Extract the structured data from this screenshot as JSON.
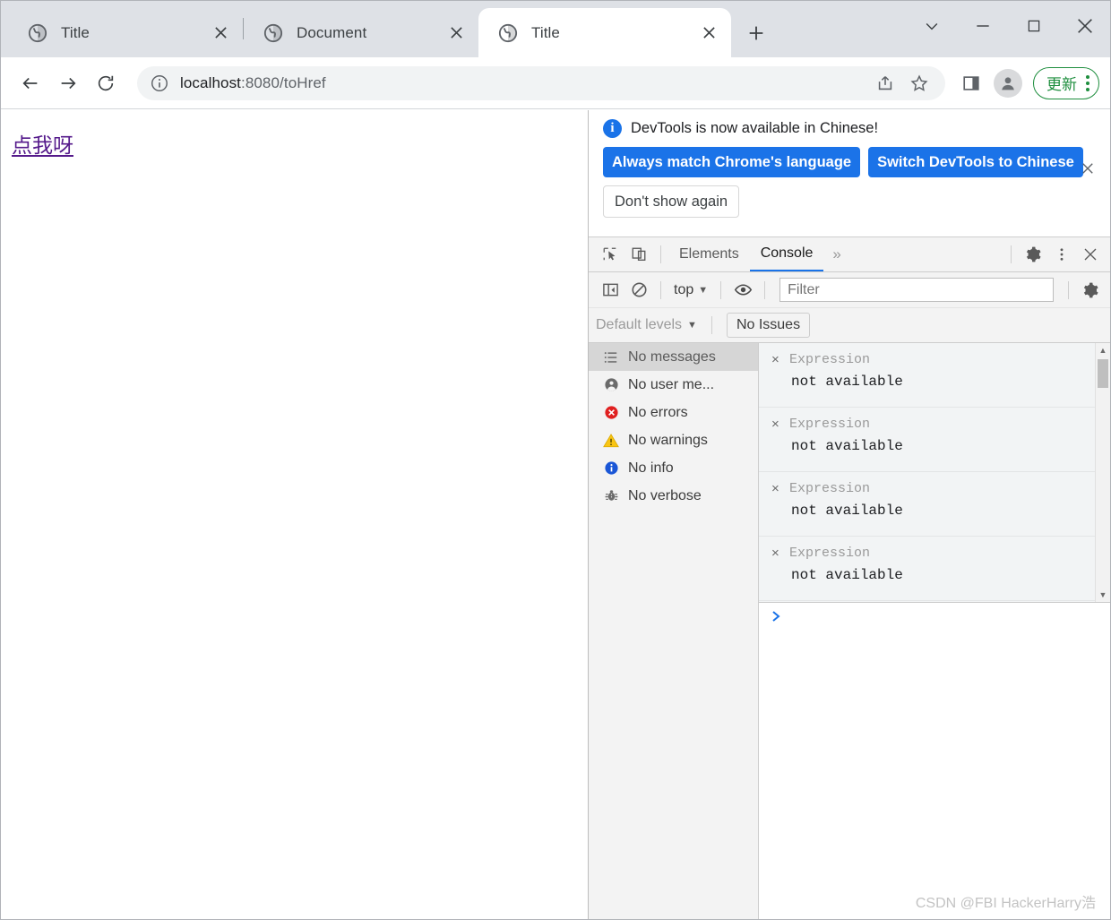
{
  "browser": {
    "tabs": [
      {
        "title": "Title",
        "active": false,
        "favicon": "globe-icon"
      },
      {
        "title": "Document",
        "active": false,
        "favicon": "globe-icon"
      },
      {
        "title": "Title",
        "active": true,
        "favicon": "globe-icon"
      }
    ],
    "new_tab_label": "+",
    "window_controls": {
      "tab_search": "chevron-down-icon",
      "minimize": "minimize-icon",
      "maximize": "maximize-icon",
      "close": "close-icon"
    },
    "toolbar": {
      "back": "back-arrow-icon",
      "forward": "forward-arrow-icon",
      "reload": "reload-icon",
      "site_info": "info-circle-icon",
      "url_host": "localhost",
      "url_rest": ":8080/toHref",
      "share": "share-icon",
      "bookmark": "star-icon",
      "side_panel": "side-panel-icon",
      "profile": "profile-avatar-icon",
      "update_label": "更新",
      "menu": "kebab-menu-icon"
    }
  },
  "page": {
    "link_text": "点我呀"
  },
  "devtools": {
    "infobar": {
      "message": "DevTools is now available in Chinese!",
      "primary_buttons": [
        "Always match Chrome's language",
        "Switch DevTools to Chinese"
      ],
      "secondary_button": "Don't show again",
      "close": "close-icon"
    },
    "tabbar": {
      "inspect_icon": "inspect-cursor-icon",
      "device_toggle_icon": "device-toolbar-icon",
      "tabs": [
        {
          "label": "Elements",
          "active": false
        },
        {
          "label": "Console",
          "active": true
        }
      ],
      "more_tabs": "»",
      "settings_icon": "gear-icon",
      "menu_icon": "kebab-menu-icon",
      "close_icon": "close-icon"
    },
    "console_toolbar": {
      "sidebar_toggle_icon": "show-console-sidebar-icon",
      "clear_icon": "clear-console-icon",
      "context": "top",
      "context_caret": "▼",
      "live_expression_icon": "eye-icon",
      "filter_placeholder": "Filter",
      "filter_value": "",
      "settings_icon": "gear-icon",
      "levels_label": "Default levels",
      "levels_caret": "▼",
      "issues_label": "No Issues"
    },
    "sidebar": {
      "items": [
        {
          "label": "No messages",
          "icon": "list-icon",
          "selected": true
        },
        {
          "label": "No user me...",
          "icon": "user-icon",
          "selected": false
        },
        {
          "label": "No errors",
          "icon": "error-icon",
          "selected": false
        },
        {
          "label": "No warnings",
          "icon": "warning-icon",
          "selected": false
        },
        {
          "label": "No info",
          "icon": "info-icon",
          "selected": false
        },
        {
          "label": "No verbose",
          "icon": "bug-icon",
          "selected": false
        }
      ]
    },
    "messages": [
      {
        "remove": "×",
        "expression": "Expression",
        "value": "not available"
      },
      {
        "remove": "×",
        "expression": "Expression",
        "value": "not available"
      },
      {
        "remove": "×",
        "expression": "Expression",
        "value": "not available"
      },
      {
        "remove": "×",
        "expression": "Expression",
        "value": "not available"
      }
    ],
    "prompt": {
      "arrow": "❯",
      "value": ""
    }
  },
  "watermark": "CSDN @FBI HackerHarry浩",
  "colors": {
    "accent_blue": "#1a73e8",
    "update_green": "#1e8e3e",
    "link_purple": "#551a8b",
    "error_red": "#d93025",
    "warning_yellow": "#f9ab00"
  }
}
